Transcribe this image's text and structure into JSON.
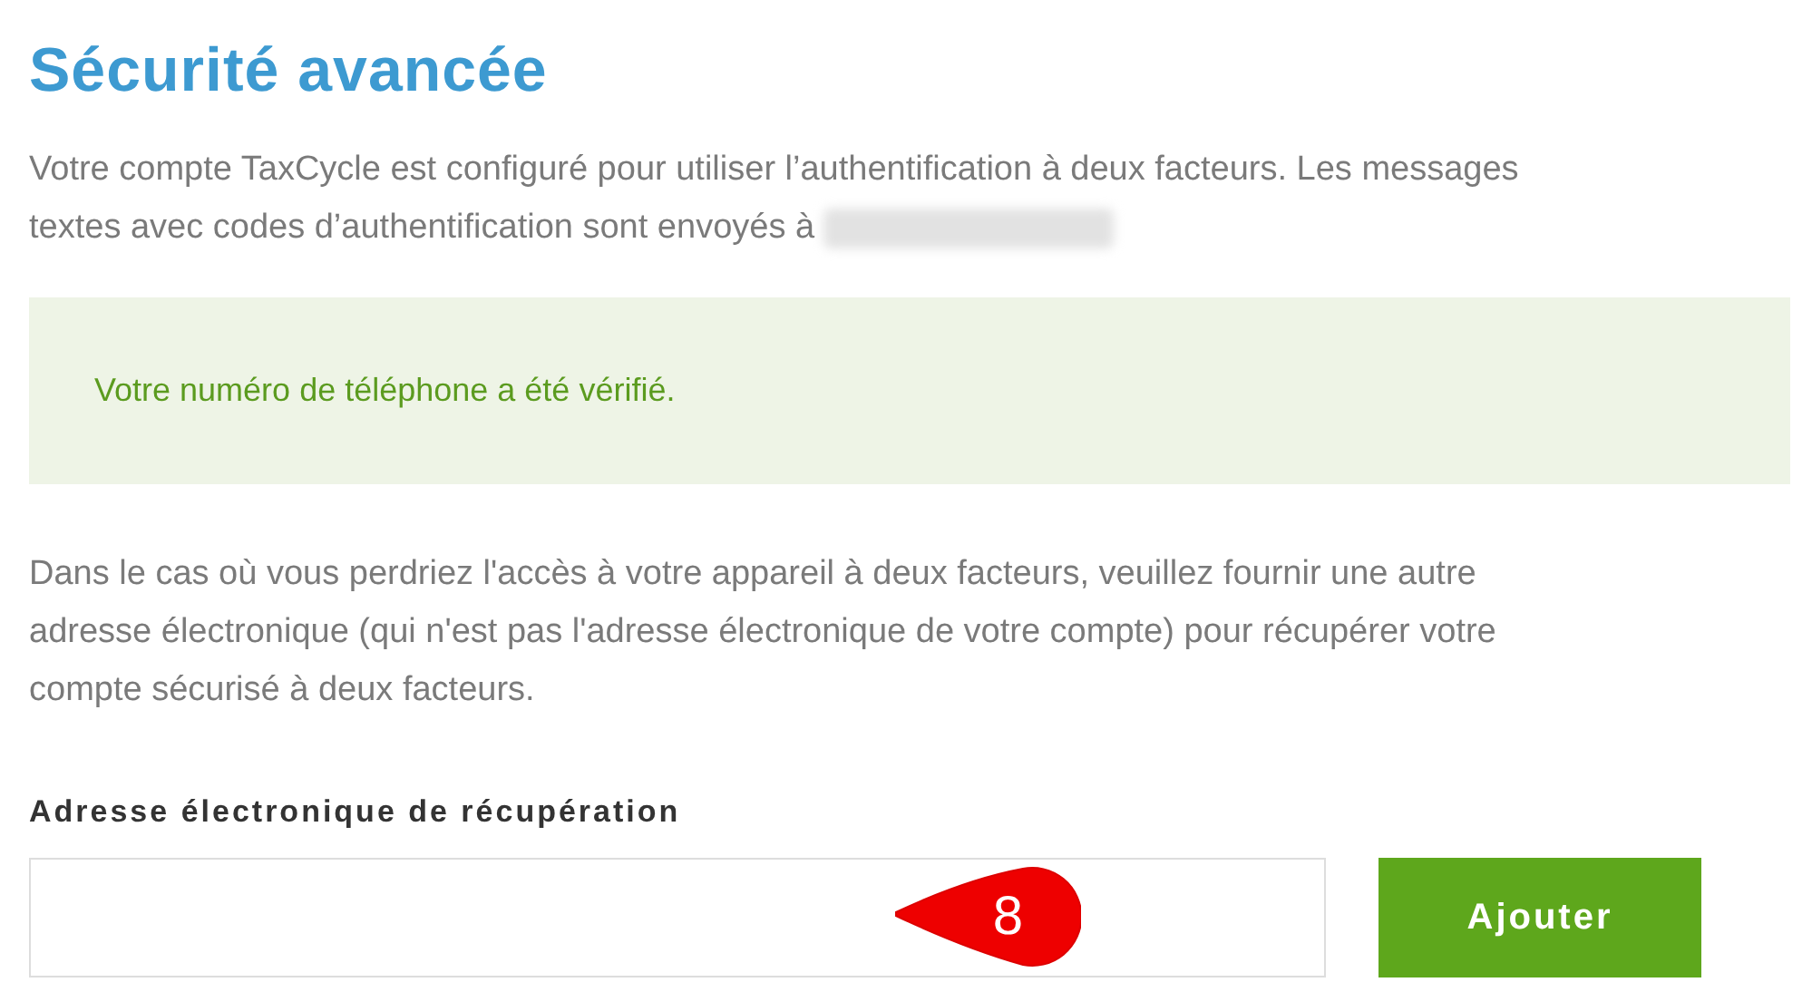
{
  "title": "Sécurité avancée",
  "intro": {
    "text": "Votre compte TaxCycle est configuré pour utiliser l’authentification à deux facteurs. Les messages textes avec codes d’authentification sont envoyés à",
    "phone_redacted": true
  },
  "alert": {
    "kind": "success",
    "text": "Votre numéro de téléphone a été vérifié."
  },
  "description": "Dans le cas où vous perdriez l'accès à votre appareil à deux facteurs, veuillez fournir une autre adresse électronique (qui n'est pas l'adresse électronique de votre compte) pour récupérer votre compte sécurisé à deux facteurs.",
  "recovery_field": {
    "label": "Adresse électronique de récupération"
  },
  "callout": {
    "text": "8"
  },
  "button": "Ajouter"
}
